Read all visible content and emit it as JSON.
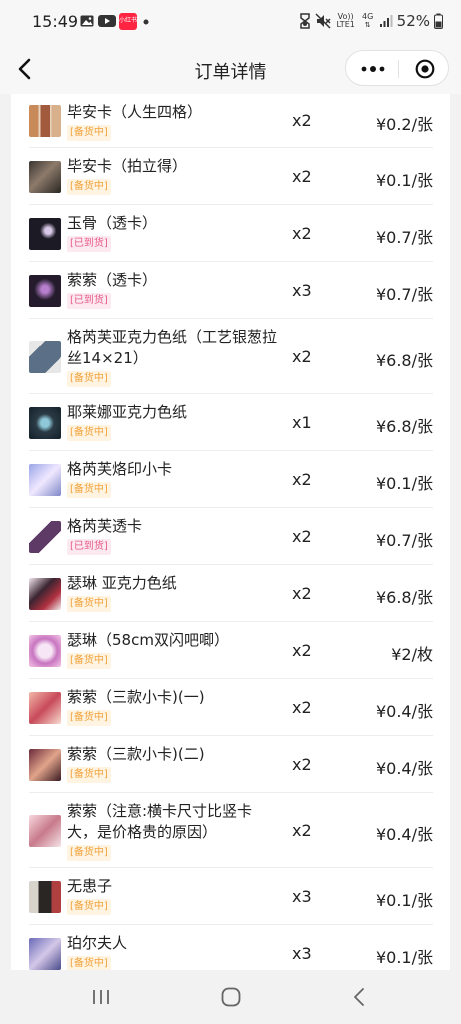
{
  "status_bar": {
    "time": "15:49",
    "app_badge": "小红书",
    "network_top": "Vo))",
    "network_bottom": "LTE1",
    "net_type": "4G",
    "battery": "52%"
  },
  "nav": {
    "title": "订单详情"
  },
  "items": [
    {
      "name": "毕安卡（人生四格）",
      "tag": "[备货中]",
      "tag_type": "stock",
      "qty": "x2",
      "price": "¥0.2/张"
    },
    {
      "name": "毕安卡（拍立得）",
      "tag": "[备货中]",
      "tag_type": "stock",
      "qty": "x2",
      "price": "¥0.1/张"
    },
    {
      "name": "玉骨（透卡）",
      "tag": "[已到货]",
      "tag_type": "arrived",
      "qty": "x2",
      "price": "¥0.7/张"
    },
    {
      "name": "萦萦（透卡）",
      "tag": "[已到货]",
      "tag_type": "arrived",
      "qty": "x3",
      "price": "¥0.7/张"
    },
    {
      "name": "格芮芙亚克力色纸（工艺银葱拉丝14×21）",
      "tag": "[备货中]",
      "tag_type": "stock",
      "qty": "x2",
      "price": "¥6.8/张"
    },
    {
      "name": "耶莱娜亚克力色纸",
      "tag": "[备货中]",
      "tag_type": "stock",
      "qty": "x1",
      "price": "¥6.8/张"
    },
    {
      "name": "格芮芙烙印小卡",
      "tag": "[备货中]",
      "tag_type": "stock",
      "qty": "x2",
      "price": "¥0.1/张"
    },
    {
      "name": "格芮芙透卡",
      "tag": "[已到货]",
      "tag_type": "arrived",
      "qty": "x2",
      "price": "¥0.7/张"
    },
    {
      "name": "瑟琳 亚克力色纸",
      "tag": "[备货中]",
      "tag_type": "stock",
      "qty": "x2",
      "price": "¥6.8/张"
    },
    {
      "name": "瑟琳（58cm双闪吧唧）",
      "tag": "[备货中]",
      "tag_type": "stock",
      "qty": "x2",
      "price": "¥2/枚"
    },
    {
      "name": "萦萦（三款小卡)(一)",
      "tag": "[备货中]",
      "tag_type": "stock",
      "qty": "x2",
      "price": "¥0.4/张"
    },
    {
      "name": "萦萦（三款小卡)(二)",
      "tag": "[备货中]",
      "tag_type": "stock",
      "qty": "x2",
      "price": "¥0.4/张"
    },
    {
      "name": "萦萦（注意:横卡尺寸比竖卡大，是价格贵的原因）",
      "tag": "[备货中]",
      "tag_type": "stock",
      "qty": "x2",
      "price": "¥0.4/张"
    },
    {
      "name": "无患子",
      "tag": "[备货中]",
      "tag_type": "stock",
      "qty": "x3",
      "price": "¥0.1/张"
    },
    {
      "name": "珀尔夫人",
      "tag": "[备货中]",
      "tag_type": "stock",
      "qty": "x3",
      "price": "¥0.1/张"
    }
  ],
  "colors": {
    "tag_stock_bg": "#fff4e2",
    "tag_stock_text": "#f0a23a",
    "tag_arrived_bg": "#fdeaf1",
    "tag_arrived_text": "#e75b8a"
  },
  "icons": {
    "back": "chevron-left-icon",
    "more": "more-dots-icon",
    "close": "target-close-icon",
    "recent_apps": "recent-apps-icon",
    "home": "home-icon",
    "system_back": "system-back-icon"
  }
}
